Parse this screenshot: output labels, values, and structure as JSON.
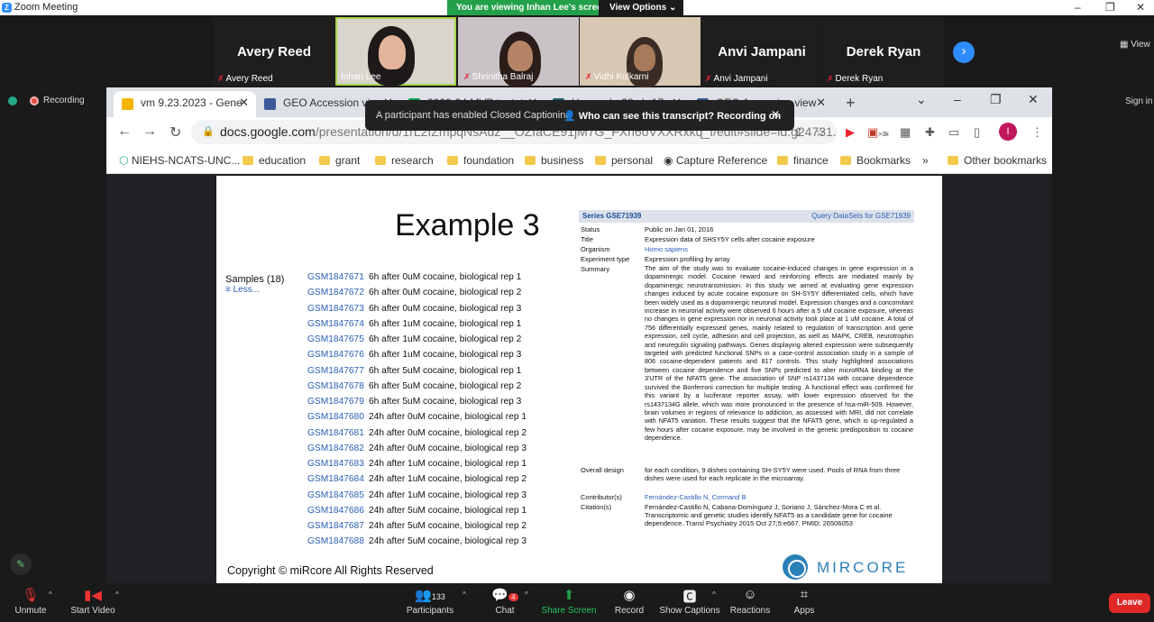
{
  "zoom": {
    "window_title": "Zoom Meeting",
    "banner_text": "You are viewing Inhan Lee's screen",
    "view_options": "View Options",
    "view_label": "View",
    "recording_label": "Recording",
    "signin": "Sign in"
  },
  "gallery": [
    {
      "big": "Avery Reed",
      "name": "Avery Reed",
      "video": false
    },
    {
      "big": "",
      "name": "Inhan Lee",
      "video": true
    },
    {
      "big": "",
      "name": "Shrinitha Balraj",
      "video": true
    },
    {
      "big": "",
      "name": "Vidhi Kulkarni",
      "video": true
    },
    {
      "big": "Anvi Jampani",
      "name": "Anvi Jampani",
      "video": false
    },
    {
      "big": "Derek Ryan",
      "name": "Derek Ryan",
      "video": false
    }
  ],
  "chrome": {
    "tabs": [
      {
        "title": "vm 9.23.2023 - Gene",
        "color": "#f4b400",
        "active": true
      },
      {
        "title": "GEO Accession view",
        "color": "#3b5998",
        "active": false
      },
      {
        "title": "2023-24 MVP tentat",
        "color": "#0f9d58",
        "active": false
      },
      {
        "title": "Human hg38 chr17",
        "color": "#1b5e6b",
        "active": false
      },
      {
        "title": "GEO Accession view",
        "color": "#3b5998",
        "active": false
      }
    ],
    "url_main": "docs.google.com",
    "url_rest": "/presentation/d/1rL2fZmpqNsAdz__OZfaCE91jM7G_FXn6oVXXRxkq_I/edit#slide=id.g24731...",
    "profile_initial": "I",
    "ext_badge": ">3k",
    "bookmarks": [
      "NIEHS-NCATS-UNC...",
      "education",
      "grant",
      "research",
      "foundation",
      "business",
      "personal",
      "Capture Reference",
      "finance",
      "Bookmarks",
      "»",
      "Other bookmarks"
    ]
  },
  "cc_toast": {
    "text1": "A participant has enabled Closed Captioning",
    "text2": "Who can see this transcript? Recording on"
  },
  "slide": {
    "title": "Example 3",
    "samples_label": "Samples (18)",
    "less": "≡ Less...",
    "samples": [
      {
        "id": "GSM1847671",
        "desc": "6h after 0uM cocaine, biological rep 1"
      },
      {
        "id": "GSM1847672",
        "desc": "6h after 0uM cocaine, biological rep 2"
      },
      {
        "id": "GSM1847673",
        "desc": "6h after 0uM cocaine, biological rep 3"
      },
      {
        "id": "GSM1847674",
        "desc": "6h after 1uM cocaine, biological rep 1"
      },
      {
        "id": "GSM1847675",
        "desc": "6h after 1uM cocaine, biological rep 2"
      },
      {
        "id": "GSM1847676",
        "desc": "6h after 1uM cocaine, biological rep 3"
      },
      {
        "id": "GSM1847677",
        "desc": "6h after 5uM cocaine, biological rep 1"
      },
      {
        "id": "GSM1847678",
        "desc": "6h after 5uM cocaine, biological rep 2"
      },
      {
        "id": "GSM1847679",
        "desc": "6h after 5uM cocaine, biological rep 3"
      },
      {
        "id": "GSM1847680",
        "desc": "24h after 0uM cocaine, biological rep 1"
      },
      {
        "id": "GSM1847681",
        "desc": "24h after 0uM cocaine, biological rep 2"
      },
      {
        "id": "GSM1847682",
        "desc": "24h after 0uM cocaine, biological rep 3"
      },
      {
        "id": "GSM1847683",
        "desc": "24h after 1uM cocaine, biological rep 1"
      },
      {
        "id": "GSM1847684",
        "desc": "24h after 1uM cocaine, biological rep 2"
      },
      {
        "id": "GSM1847685",
        "desc": "24h after 1uM cocaine, biological rep 3"
      },
      {
        "id": "GSM1847686",
        "desc": "24h after 5uM cocaine, biological rep 1"
      },
      {
        "id": "GSM1847687",
        "desc": "24h after 5uM cocaine, biological rep 2"
      },
      {
        "id": "GSM1847688",
        "desc": "24h after 5uM cocaine, biological rep 3"
      }
    ],
    "geo": {
      "series": "Series GSE71939",
      "query": "Query DataSets for GSE71939",
      "status_label": "Status",
      "status": "Public on Jan 01, 2016",
      "title_label": "Title",
      "title": "Expression data of SHSY5Y cells after cocaine exposure",
      "organism_label": "Organism",
      "organism": "Homo sapiens",
      "exptype_label": "Experiment type",
      "exptype": "Expression profiling by array",
      "summary_label": "Summary",
      "summary": "The aim of the study was to evaluate cocaine-induced changes in gene expression in a dopaminergic model. Cocaine reward and reinforcing effects are mediated mainly by dopaminergic neurotransmission. In this study we aimed at evaluating gene expression changes induced by acute cocaine exposure on SH-SY5Y differentiated cells, which have been widely used as a dopaminergic neuronal model. Expression changes and a concomitant increase in neuronal activity were observed 6 hours after a 5 uM cocaine exposure, whereas no changes in gene expression nor in neuronal activity took place at 1 uM cocaine. A total of 756 differentially expressed genes, mainly related to regulation of transcription and gene expression, cell cycle, adhesion and cell projection, as well as MAPK, CREB, neurotrophin and neuregulin signaling pathways. Genes displaying altered expression were subsequently targeted with predicted functional SNPs in a case-control association study in a sample of 806 cocaine-dependent patients and 817 controls. This study highlighted associations between cocaine dependence and five SNPs predicted to alter microRNA binding at the 3'UTR of the NFAT5 gene. The association of SNP rs1437134 with cocaine dependence survived the Bonferroni correction for multiple testing. A functional effect was confirmed for this variant by a luciferase reporter assay, with lower expression observed for the rs1437134G allele, which was more pronounced in the presence of hsa-miR-509. However, brain volumes in regions of relevance to addiction, as assessed with MRI, did not correlate with NFAT5 variation. These results suggest that the NFAT5 gene, which is up-regulated a few hours after cocaine exposure, may be involved in the genetic predisposition to cocaine dependence.",
      "design_label": "Overall design",
      "design": "for each condition, 9 dishes containing SH-SY5Y were used. Pools of RNA from three dishes were used for each replicate in the microarray.",
      "contrib_label": "Contributor(s)",
      "contrib": "Fernández-Castillo N, Cormand B",
      "citation_label": "Citation(s)",
      "citation": "Fernández-Castillo N, Cabana-Domínguez J, Soriano J, Sánchez-Mora C et al. Transcriptomic and genetic studies identify NFAT5 as a candidate gene for cocaine dependence. Transl Psychiatry 2015 Oct 27;5:e667. PMID: 26506053"
    },
    "copyright": "Copyright © miRcore All Rights Reserved",
    "brand": "MIRCORE"
  },
  "controls": {
    "unmute": "Unmute",
    "start_video": "Start Video",
    "participants": "Participants",
    "participants_count": "133",
    "chat": "Chat",
    "chat_badge": "4",
    "share": "Share Screen",
    "record": "Record",
    "captions": "Show Captions",
    "reactions": "Reactions",
    "apps": "Apps",
    "leave": "Leave"
  }
}
